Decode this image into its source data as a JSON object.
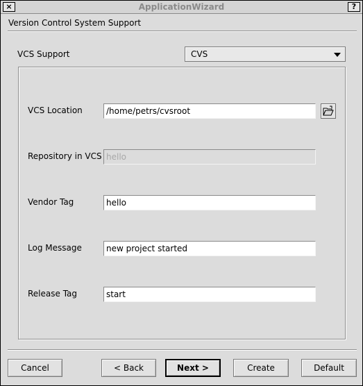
{
  "window": {
    "title": "ApplicationWizard",
    "close_label": "×",
    "help_label": "?"
  },
  "section": {
    "title": "Version Control System Support"
  },
  "vcs_support": {
    "label": "VCS Support",
    "selected": "CVS"
  },
  "fields": {
    "vcs_location": {
      "label": "VCS Location",
      "value": "/home/petrs/cvsroot"
    },
    "repository": {
      "label": "Repository in VCS",
      "value": "hello"
    },
    "vendor_tag": {
      "label": "Vendor Tag",
      "value": "hello"
    },
    "log_message": {
      "label": "Log Message",
      "value": "new project started"
    },
    "release_tag": {
      "label": "Release Tag",
      "value": "start"
    }
  },
  "buttons": {
    "cancel": "Cancel",
    "back": "< Back",
    "next": "Next >",
    "create": "Create",
    "default": "Default"
  },
  "icons": {
    "browse": "folder-open-icon"
  }
}
